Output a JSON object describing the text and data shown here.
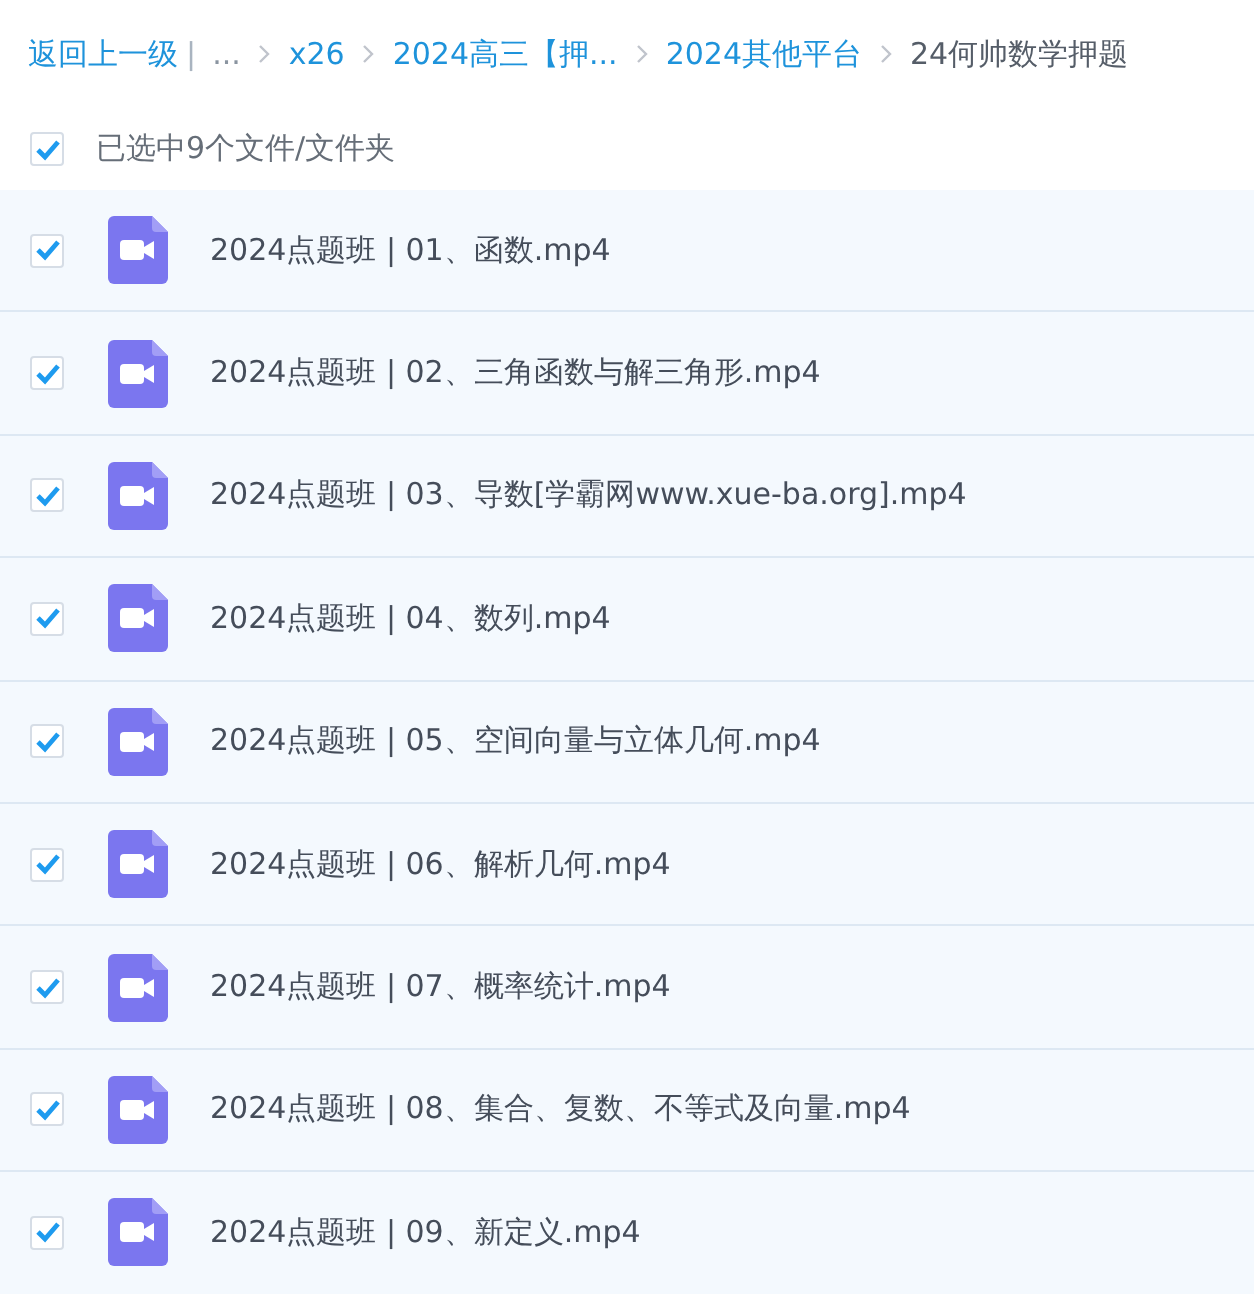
{
  "breadcrumb": {
    "back": "返回上一级",
    "separator": "|",
    "items": [
      {
        "label": "...",
        "kind": "ellipsis"
      },
      {
        "label": "x26",
        "kind": "link"
      },
      {
        "label": "2024高三【押...",
        "kind": "link"
      },
      {
        "label": "2024其他平台",
        "kind": "link"
      },
      {
        "label": "24何帅数学押题",
        "kind": "current"
      }
    ]
  },
  "selection": {
    "checked": true,
    "label": "已选中9个文件/文件夹"
  },
  "files": [
    {
      "name": "2024点题班 | 01、函数.mp4",
      "checked": true
    },
    {
      "name": "2024点题班 | 02、三角函数与解三角形.mp4",
      "checked": true
    },
    {
      "name": "2024点题班 | 03、导数[学霸网www.xue-ba.org].mp4",
      "checked": true
    },
    {
      "name": "2024点题班 | 04、数列.mp4",
      "checked": true
    },
    {
      "name": "2024点题班 | 05、空间向量与立体几何.mp4",
      "checked": true
    },
    {
      "name": "2024点题班 | 06、解析几何.mp4",
      "checked": true
    },
    {
      "name": "2024点题班 | 07、概率统计.mp4",
      "checked": true
    },
    {
      "name": "2024点题班 | 08、集合、复数、不等式及向量.mp4",
      "checked": true
    },
    {
      "name": "2024点题班 | 09、新定义.mp4",
      "checked": true
    }
  ]
}
